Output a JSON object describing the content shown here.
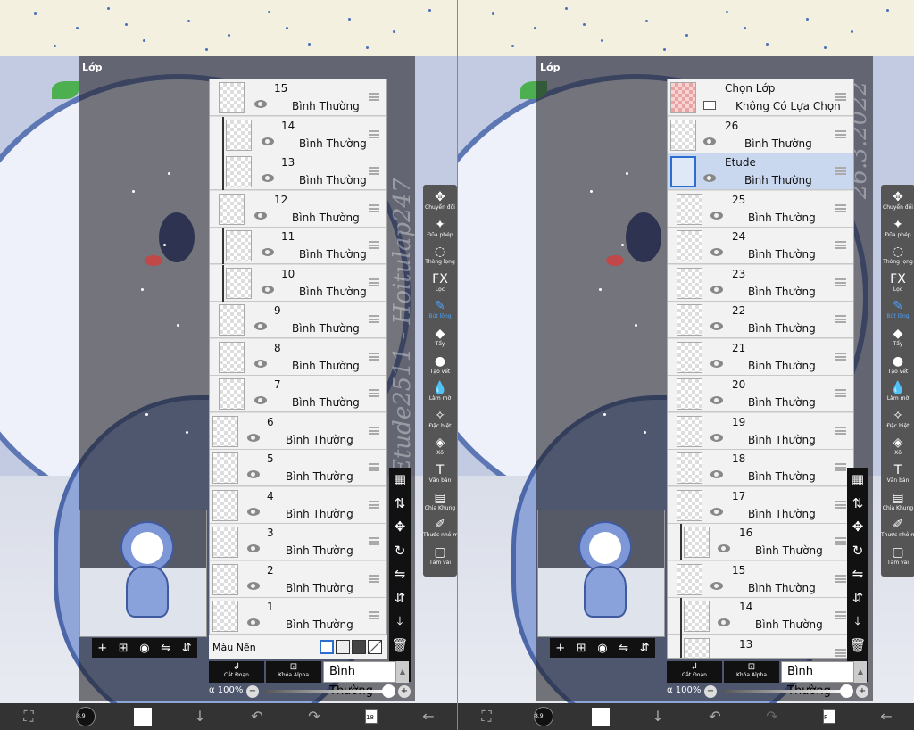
{
  "colors": {
    "accent": "#2a6fd0",
    "active_tool": "#4da3ff",
    "selected_row": "#c9d8ef"
  },
  "left": {
    "panel_title": "Lớp",
    "watermark": "Etude2511 - Hoitulap247",
    "layers": [
      {
        "name": "15",
        "mode": "Bình Thường",
        "clipped": false,
        "thumb": "checker"
      },
      {
        "name": "14",
        "mode": "Bình Thường",
        "clipped": true,
        "thumb": "checker"
      },
      {
        "name": "13",
        "mode": "Bình Thường",
        "clipped": true,
        "thumb": "checker"
      },
      {
        "name": "12",
        "mode": "Bình Thường",
        "clipped": false,
        "thumb": "checker"
      },
      {
        "name": "11",
        "mode": "Bình Thường",
        "clipped": true,
        "thumb": "checker"
      },
      {
        "name": "10",
        "mode": "Bình Thường",
        "clipped": true,
        "thumb": "checker"
      },
      {
        "name": "9",
        "mode": "Bình Thường",
        "clipped": false,
        "thumb": "checker"
      },
      {
        "name": "8",
        "mode": "Bình Thường",
        "clipped": false,
        "thumb": "checker"
      },
      {
        "name": "7",
        "mode": "Bình Thường",
        "clipped": false,
        "thumb": "checker"
      },
      {
        "name": "6",
        "mode": "Bình Thường",
        "clipped": false,
        "thumb": "checker"
      },
      {
        "name": "5",
        "mode": "Bình Thường",
        "clipped": false,
        "thumb": "checker"
      },
      {
        "name": "4",
        "mode": "Bình Thường",
        "clipped": false,
        "thumb": "checker"
      },
      {
        "name": "3",
        "mode": "Bình Thường",
        "clipped": false,
        "thumb": "checker"
      },
      {
        "name": "2",
        "mode": "Bình Thường",
        "clipped": false,
        "thumb": "checker"
      },
      {
        "name": "1",
        "mode": "Bình Thường",
        "clipped": false,
        "thumb": "checker"
      }
    ],
    "background_label": "Màu Nền",
    "bottom": {
      "clip_label": "Cắt Đoạn",
      "alpha_lock_label": "Khóa Alpha",
      "blend_mode": "Bình Thường"
    },
    "alpha": {
      "symbol": "α",
      "value": "100%",
      "fraction": 1.0
    },
    "layer_count": "18"
  },
  "right": {
    "panel_title": "Lớp",
    "watermark": "26.3.2022",
    "selection_layer": {
      "name": "Chọn Lớp",
      "mode": "Không Có Lựa Chọn"
    },
    "layers": [
      {
        "name": "26",
        "mode": "Bình Thường",
        "clipped": false,
        "thumb": "checker"
      },
      {
        "name": "Etude",
        "mode": "Bình Thường",
        "clipped": false,
        "thumb": "sel",
        "selected": true
      },
      {
        "name": "25",
        "mode": "Bình Thường",
        "clipped": false,
        "thumb": "checker"
      },
      {
        "name": "24",
        "mode": "Bình Thường",
        "clipped": false,
        "thumb": "checker"
      },
      {
        "name": "23",
        "mode": "Bình Thường",
        "clipped": false,
        "thumb": "checker"
      },
      {
        "name": "22",
        "mode": "Bình Thường",
        "clipped": false,
        "thumb": "checker"
      },
      {
        "name": "21",
        "mode": "Bình Thường",
        "clipped": false,
        "thumb": "checker"
      },
      {
        "name": "20",
        "mode": "Bình Thường",
        "clipped": false,
        "thumb": "checker"
      },
      {
        "name": "19",
        "mode": "Bình Thường",
        "clipped": false,
        "thumb": "checker"
      },
      {
        "name": "18",
        "mode": "Bình Thường",
        "clipped": false,
        "thumb": "checker"
      },
      {
        "name": "17",
        "mode": "Bình Thường",
        "clipped": false,
        "thumb": "checker"
      },
      {
        "name": "16",
        "mode": "Bình Thường",
        "clipped": true,
        "thumb": "checker"
      },
      {
        "name": "15",
        "mode": "Bình Thường",
        "clipped": false,
        "thumb": "checker"
      },
      {
        "name": "14",
        "mode": "Bình Thường",
        "clipped": true,
        "thumb": "checker"
      },
      {
        "name": "13",
        "mode": "",
        "clipped": true,
        "thumb": "checker"
      }
    ],
    "bottom": {
      "clip_label": "Cắt Đoạn",
      "alpha_lock_label": "Khóa Alpha",
      "blend_mode": "Bình Thường"
    },
    "alpha": {
      "symbol": "α",
      "value": "100%",
      "fraction": 1.0
    },
    "layer_count": "F"
  },
  "tools": [
    {
      "id": "transform",
      "label": "Chuyển đổi",
      "icon": "move-icon",
      "glyph": "✥"
    },
    {
      "id": "magic-wand",
      "label": "Đũa phép",
      "icon": "magic-wand-icon",
      "glyph": "✦"
    },
    {
      "id": "lasso",
      "label": "Thòng lọng",
      "icon": "lasso-icon",
      "glyph": "◌"
    },
    {
      "id": "filter",
      "label": "Lọc",
      "icon": "fx-icon",
      "glyph": "FX"
    },
    {
      "id": "brush",
      "label": "Bút lông",
      "icon": "brush-icon",
      "glyph": "✎",
      "active": true
    },
    {
      "id": "eraser",
      "label": "Tẩy",
      "icon": "eraser-icon",
      "glyph": "◆"
    },
    {
      "id": "smudge",
      "label": "Tạo vết",
      "icon": "smudge-icon",
      "glyph": "●"
    },
    {
      "id": "blur",
      "label": "Làm mờ",
      "icon": "drop-icon",
      "glyph": "💧"
    },
    {
      "id": "special",
      "label": "Đặc biệt",
      "icon": "sparkle-wand-icon",
      "glyph": "✧"
    },
    {
      "id": "fill",
      "label": "Xô",
      "icon": "bucket-icon",
      "glyph": "◈"
    },
    {
      "id": "text",
      "label": "Văn bản",
      "icon": "text-icon",
      "glyph": "T"
    },
    {
      "id": "frame",
      "label": "Chia Khung",
      "icon": "frame-icon",
      "glyph": "▤"
    },
    {
      "id": "eyedropper",
      "label": "Thước nhỏ mắt",
      "icon": "eyedropper-icon",
      "glyph": "✐"
    },
    {
      "id": "canvas",
      "label": "Tấm vải",
      "icon": "canvas-icon",
      "glyph": "▢"
    }
  ],
  "layer_tools": [
    {
      "icon": "checker-icon",
      "glyph": "▦"
    },
    {
      "icon": "merge-layers-icon",
      "glyph": "⇅"
    },
    {
      "icon": "move-layer-icon",
      "glyph": "✥"
    },
    {
      "icon": "rotate-icon",
      "glyph": "↻"
    },
    {
      "icon": "flip-horizontal-icon",
      "glyph": "⇋"
    },
    {
      "icon": "flip-vertical-icon",
      "glyph": "⇵"
    },
    {
      "icon": "merge-down-icon",
      "glyph": "⤓"
    },
    {
      "icon": "trash-icon",
      "glyph": "🗑"
    },
    {
      "icon": "more-icon",
      "glyph": "⋮"
    }
  ],
  "preview_tools": [
    {
      "icon": "add-layer-icon",
      "glyph": "+"
    },
    {
      "icon": "add-folder-icon",
      "glyph": "⊞"
    },
    {
      "icon": "camera-icon",
      "glyph": "◉"
    },
    {
      "icon": "flip-h-icon",
      "glyph": "⇋"
    },
    {
      "icon": "flip-v-icon",
      "glyph": "⇵"
    }
  ],
  "bottombar": {
    "brush_size": "8.9"
  }
}
